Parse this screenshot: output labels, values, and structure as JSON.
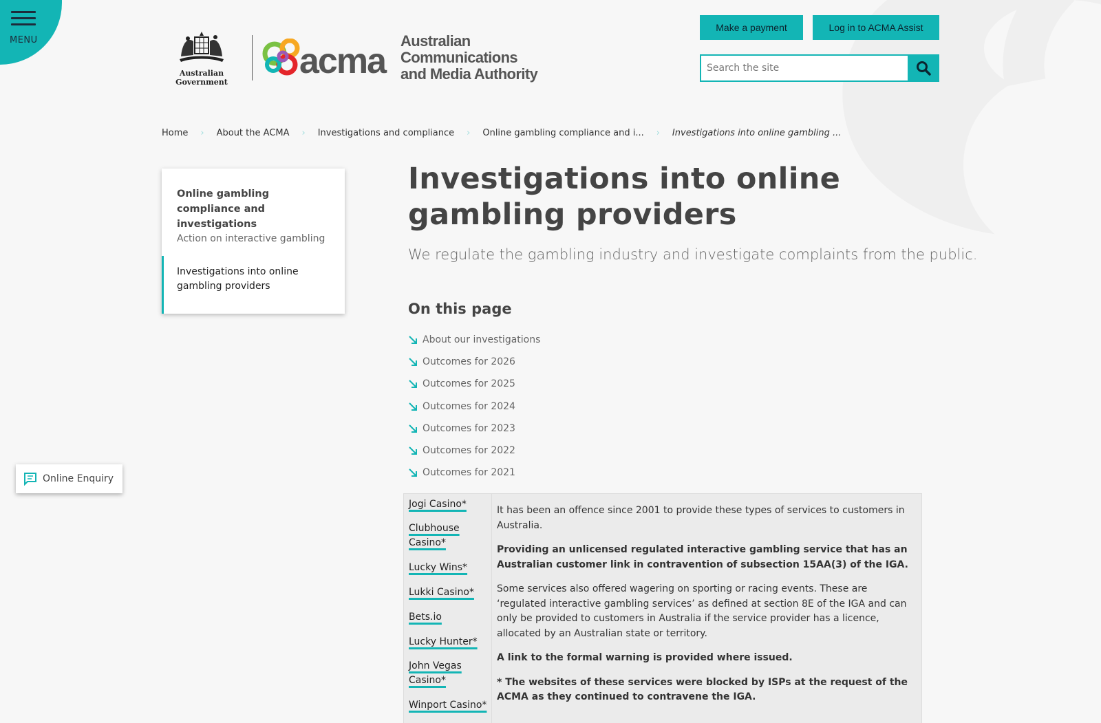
{
  "header": {
    "menu_label": "MENU",
    "gov_label": "Australian Government",
    "acma_word": "acma",
    "acma_full_1": "Australian",
    "acma_full_2": "Communications",
    "acma_full_3": "and Media Authority",
    "pay_label": "Make a payment",
    "login_label": "Log in to ACMA Assist",
    "search_placeholder": "Search the site",
    "accent_color": "#13b5b5"
  },
  "breadcrumb": [
    "Home",
    "About the ACMA",
    "Investigations and compliance",
    "Online gambling compliance and i...",
    "Investigations into online gambling ..."
  ],
  "sidenav": {
    "title": "Online gambling compliance and investigations",
    "item": "Action on interactive gambling",
    "active": "Investigations into online gambling providers"
  },
  "main": {
    "title": "Investigations into online gambling providers",
    "subtitle": "We regulate the gambling industry and investigate complaints from the public.",
    "otp_title": "On this page",
    "otp_items": [
      "About our investigations",
      "Outcomes for 2026",
      "Outcomes for 2025",
      "Outcomes for 2024",
      "Outcomes for 2023",
      "Outcomes for 2022",
      "Outcomes for 2021"
    ]
  },
  "enquiry_label": "Online Enquiry",
  "table": {
    "links": [
      "Jogi Casino*",
      "Clubhouse Casino*",
      "Lucky Wins*",
      "Lukki Casino*",
      "Bets.io",
      "Lucky Hunter*",
      "John Vegas Casino*",
      "Winport Casino*"
    ],
    "paragraphs": [
      "It has been an offence since 2001 to provide these types of services to customers in Australia.",
      "Providing an unlicensed regulated interactive gambling service that has an Australian customer link in contravention of subsection 15AA(3) of the IGA.",
      "Some services also offered wagering on sporting or racing events. These are ‘regulated interactive gambling services’ as defined at section 8E of the IGA and can only be provided to customers in Australia if the service provider has a licence, allocated by an Australian state or territory.",
      "A link to the formal warning is provided where issued.",
      "* The websites of these services were blocked by ISPs at the request of the ACMA as they continued to contravene the IGA."
    ]
  }
}
